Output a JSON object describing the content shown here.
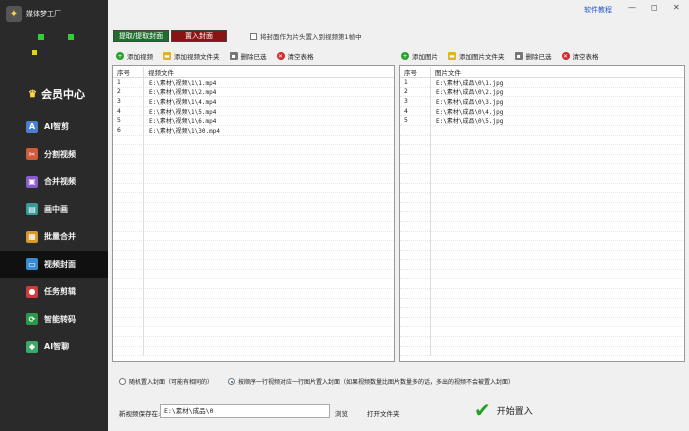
{
  "app": {
    "title": "媒体梦工厂",
    "logo_glyph": "✦"
  },
  "sidebar": {
    "vip_label": "会员中心",
    "vip_icon": "crown-icon",
    "items": [
      {
        "label": "AI智剪",
        "icon": "ai-cut-icon",
        "glyph": "A",
        "color": "#4a7fd0"
      },
      {
        "label": "分割视频",
        "icon": "split-video-icon",
        "glyph": "✂",
        "color": "#d05a3a"
      },
      {
        "label": "合并视频",
        "icon": "merge-video-icon",
        "glyph": "▣",
        "color": "#8a5ad0"
      },
      {
        "label": "画中画",
        "icon": "pip-icon",
        "glyph": "▤",
        "color": "#3a9a9a"
      },
      {
        "label": "批量合并",
        "icon": "batch-merge-icon",
        "glyph": "▦",
        "color": "#d09a2a"
      },
      {
        "label": "视频封面",
        "icon": "video-cover-icon",
        "glyph": "▭",
        "color": "#3a8ad0",
        "active": true
      },
      {
        "label": "任务剪辑",
        "icon": "task-edit-icon",
        "glyph": "●",
        "color": "#d03a3a"
      },
      {
        "label": "智能转码",
        "icon": "transcode-icon",
        "glyph": "⟳",
        "color": "#2a9a4a"
      },
      {
        "label": "AI智聊",
        "icon": "ai-chat-icon",
        "glyph": "◆",
        "color": "#3aaa6a"
      }
    ]
  },
  "topbar": {
    "help_label": "软件教程",
    "minimize": "—",
    "restore": "◻",
    "close": "✕"
  },
  "modes": {
    "extract_label": "提取/提取封面",
    "insert_label": "置入封面"
  },
  "options": {
    "first_frame_label": "将封面作为片头置入到视频第1帧中"
  },
  "video_toolbar": {
    "add": "添加视频",
    "add_folder": "添加视频文件夹",
    "delete": "删除已选",
    "clear": "清空表格"
  },
  "image_toolbar": {
    "add": "添加图片",
    "add_folder": "添加图片文件夹",
    "delete": "删除已选",
    "clear": "清空表格"
  },
  "video_table": {
    "col_no": "序号",
    "col_file": "视频文件",
    "rows": [
      {
        "no": "1",
        "file": "E:\\素材\\视频\\1\\1.mp4"
      },
      {
        "no": "2",
        "file": "E:\\素材\\视频\\1\\2.mp4"
      },
      {
        "no": "3",
        "file": "E:\\素材\\视频\\1\\4.mp4"
      },
      {
        "no": "4",
        "file": "E:\\素材\\视频\\1\\5.mp4"
      },
      {
        "no": "5",
        "file": "E:\\素材\\视频\\1\\6.mp4"
      },
      {
        "no": "6",
        "file": "E:\\素材\\视频\\1\\30.mp4"
      }
    ]
  },
  "image_table": {
    "col_no": "序号",
    "col_file": "图片文件",
    "rows": [
      {
        "no": "1",
        "file": "E:\\素材\\成品\\0\\1.jpg"
      },
      {
        "no": "2",
        "file": "E:\\素材\\成品\\0\\2.jpg"
      },
      {
        "no": "3",
        "file": "E:\\素材\\成品\\0\\3.jpg"
      },
      {
        "no": "4",
        "file": "E:\\素材\\成品\\0\\4.jpg"
      },
      {
        "no": "5",
        "file": "E:\\素材\\成品\\0\\5.jpg"
      }
    ]
  },
  "placement": {
    "random_label": "随机置入封面（可能有相同的）",
    "sequential_label": "按顺序一行视频对应一行图片置入封面（如果视频数量比图片数量多的话，多出的视频不会被置入封面）",
    "selected": "sequential"
  },
  "output": {
    "save_label": "新视频保存在:",
    "save_path": "E:\\素材\\成品\\0",
    "browse_label": "浏览",
    "open_folder_label": "打开文件夹"
  },
  "start": {
    "label": "开始置入"
  }
}
